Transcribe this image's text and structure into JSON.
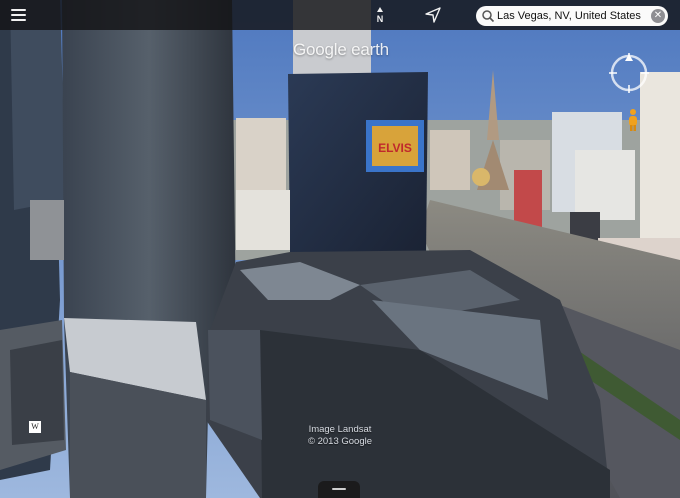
{
  "toolbar": {
    "menu_icon": "hamburger-menu-icon",
    "north_label": "N",
    "locate_icon": "location-arrow-icon"
  },
  "search": {
    "value": "Las Vegas, NV, United States",
    "icon": "search-icon",
    "clear_icon": "close-icon",
    "clear_glyph": "✕"
  },
  "brand": {
    "text": "Google earth"
  },
  "attribution": {
    "line1": "Image Landsat",
    "line2": "© 2013 Google"
  },
  "map_labels": {
    "billboard": "ELVIS",
    "building_badge": "W"
  },
  "colors": {
    "sky": "#6b8fc4",
    "toolbar": "#141416",
    "roads": "#5e6068"
  }
}
